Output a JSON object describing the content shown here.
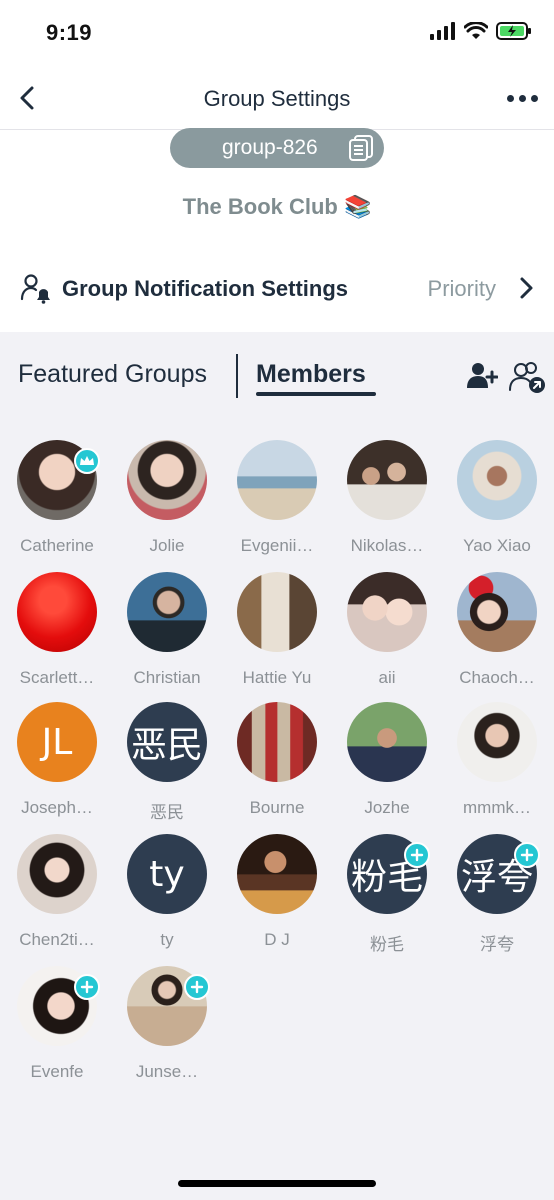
{
  "status_bar": {
    "time": "9:19"
  },
  "nav": {
    "title": "Group Settings",
    "back_icon": "chevron-left-icon",
    "more_icon": "ellipsis-icon"
  },
  "group": {
    "id_label": "group-826",
    "name": "The Book Club 📚",
    "copy_icon": "copy-icon"
  },
  "notification": {
    "label": "Group Notification Settings",
    "value": "Priority",
    "icon": "bell-person-icon"
  },
  "tabs": {
    "featured": "Featured Groups",
    "members": "Members"
  },
  "accent_color": "#25c7d3",
  "members": [
    {
      "name": "Catherine",
      "badge": "crown"
    },
    {
      "name": "Jolie"
    },
    {
      "name": "Evgenii…"
    },
    {
      "name": "Nikolas…"
    },
    {
      "name": "Yao Xiao"
    },
    {
      "name": "Scarlett…"
    },
    {
      "name": "Christian"
    },
    {
      "name": "Hattie Yu"
    },
    {
      "name": "aii"
    },
    {
      "name": "Chaoch…"
    },
    {
      "name": "Joseph…",
      "initials": "JL"
    },
    {
      "name": "恶民",
      "initials": "恶民"
    },
    {
      "name": "Bourne"
    },
    {
      "name": "Jozhe"
    },
    {
      "name": "mmmk…"
    },
    {
      "name": "Chen2ti…"
    },
    {
      "name": "ty",
      "initials": "ty"
    },
    {
      "name": "D J"
    },
    {
      "name": "粉毛",
      "initials": "粉毛",
      "badge": "plus"
    },
    {
      "name": "浮夸",
      "initials": "浮夸",
      "badge": "plus"
    },
    {
      "name": "Evenfe",
      "badge": "plus"
    },
    {
      "name": "Junse…",
      "badge": "plus"
    }
  ]
}
